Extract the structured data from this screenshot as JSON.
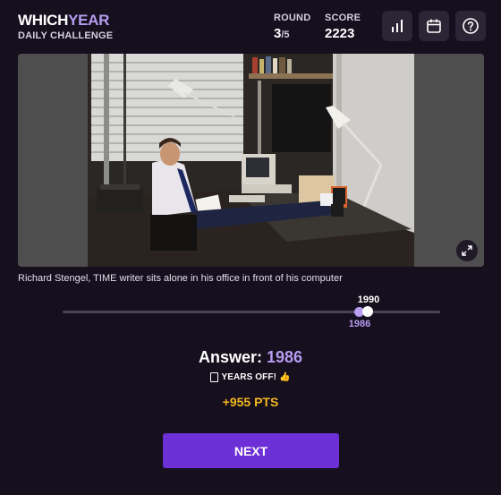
{
  "header": {
    "logo_part1": "WHICH",
    "logo_part2": "YEAR",
    "subtitle": "DAILY CHALLENGE",
    "round_label": "ROUND",
    "round_current": "3",
    "round_total": "/5",
    "score_label": "SCORE",
    "score_value": "2223",
    "icons": [
      "bar-chart-icon",
      "calendar-icon",
      "help-icon"
    ]
  },
  "photo": {
    "caption": "Richard Stengel, TIME writer sits alone in his office in front of his computer",
    "expand_icon": "expand-icon"
  },
  "timeline": {
    "correct_year": "1990",
    "guess_year": "1986"
  },
  "result": {
    "answer_label": "Answer:",
    "answer_year": "1986",
    "years_off_text": "YEARS OFF!",
    "years_off_emoji": "👍",
    "points": "+955 PTS"
  },
  "actions": {
    "next_label": "NEXT"
  },
  "colors": {
    "background": "#150f1e",
    "accent": "#b79cf0",
    "points": "#f5b81f",
    "button": "#6d2fd6"
  }
}
